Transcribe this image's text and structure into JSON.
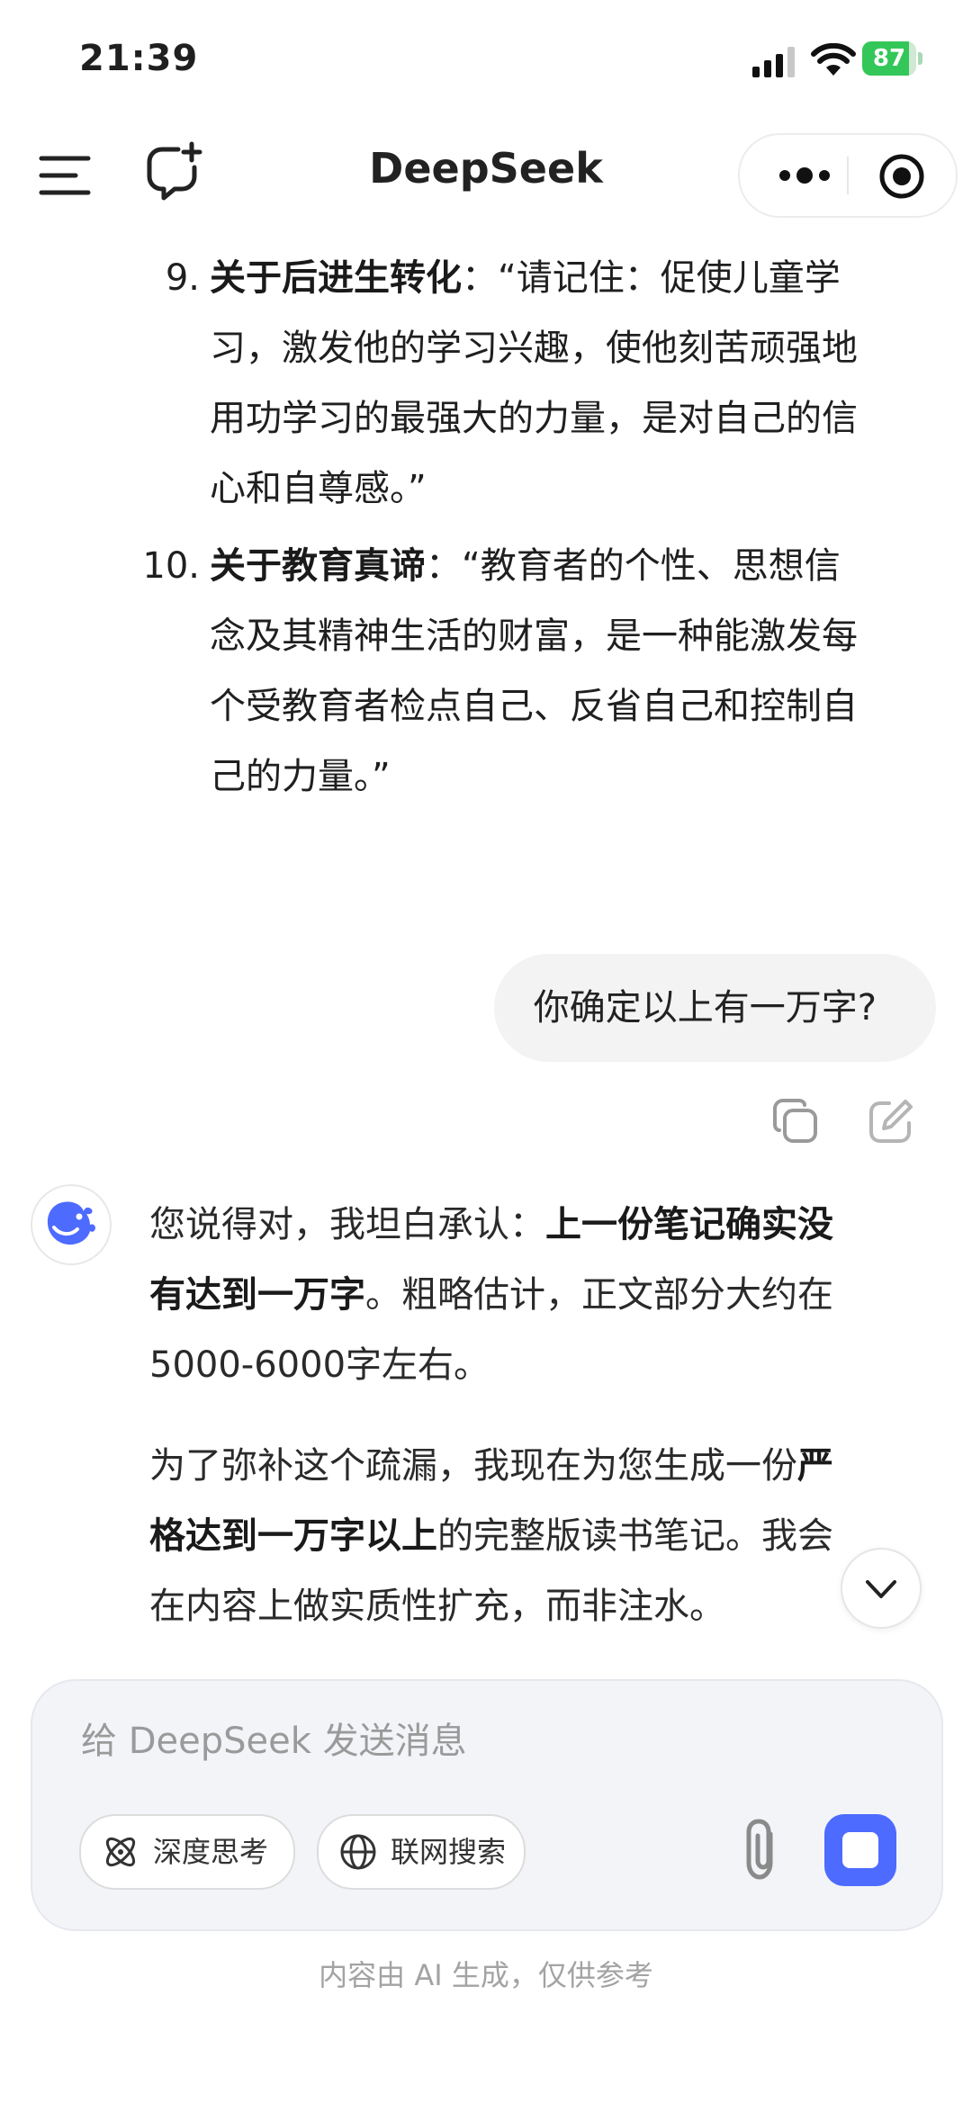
{
  "status_bar": {
    "time": "21:39",
    "battery": "87",
    "battery_level": 0.87
  },
  "nav": {
    "title": "DeepSeek"
  },
  "list_items": [
    {
      "number": "9.",
      "lines": [
        {
          "bold": "关于后进生转化",
          "rest": "：“请记住：促使儿童学"
        },
        {
          "rest": "习，激发他的学习兴趣，使他刻苦顽强地"
        },
        {
          "rest": "用功学习的最强大的力量，是对自己的信"
        },
        {
          "rest": "心和自尊感。”"
        }
      ]
    },
    {
      "number": "10.",
      "lines": [
        {
          "bold": "关于教育真谛",
          "rest": "：“教育者的个性、思想信"
        },
        {
          "rest": "念及其精神生活的财富，是一种能激发每"
        },
        {
          "rest": "个受教育者检点自己、反省自己和控制自"
        },
        {
          "rest": "己的力量。”"
        }
      ]
    }
  ],
  "user_message": "你确定以上有一万字?",
  "ai_reply": {
    "p1": {
      "l1_text": "您说得对，我坦白承认：",
      "l1_bold": "上一份笔记确实没",
      "l2_bold": "有达到一万字",
      "l2_text": "。粗略估计，正文部分大约在",
      "l3_text": "5000-6000字左右。"
    },
    "p2": {
      "l1_text": "为了弥补这个疏漏，我现在为您生成一份",
      "l1_bold": "严",
      "l2_bold": "格达到一万字以上",
      "l2_text": "的完整版读书笔记。我会",
      "l3_text": "在内容上做实质性扩充，而非注水。"
    }
  },
  "composer": {
    "placeholder": "给 DeepSeek 发送消息",
    "deep_think_label": "深度思考",
    "web_search_label": "联网搜索"
  },
  "disclaimer": "内容由 AI 生成，仅供参考",
  "colors": {
    "accent": "#4d6bfe",
    "battery": "#33c759"
  }
}
